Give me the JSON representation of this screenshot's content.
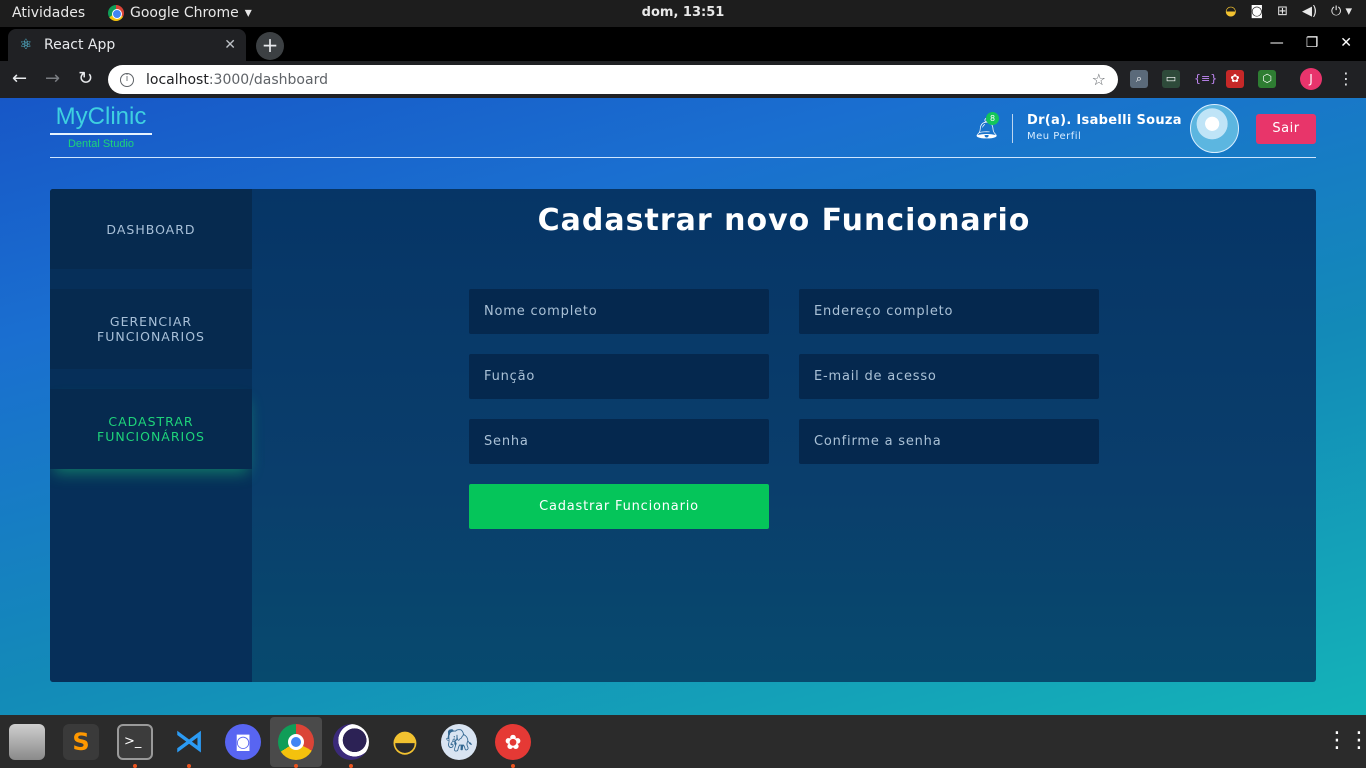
{
  "system": {
    "activities": "Atividades",
    "app_menu": "Google Chrome",
    "clock": "dom, 13:51"
  },
  "browser": {
    "tab_title": "React App",
    "url_host": "localhost",
    "url_path": ":3000/dashboard",
    "profile_initial": "J"
  },
  "header": {
    "brand_name": "MyClinic",
    "brand_sub": "Dental Studio",
    "notification_count": "8",
    "user_name": "Dr(a). Isabelli Souza",
    "user_link": "Meu Perfil",
    "logout_label": "Sair"
  },
  "sidebar": {
    "items": [
      {
        "label": "DASHBOARD"
      },
      {
        "label": "GERENCIAR FUNCIONARIOS"
      },
      {
        "label": "CADASTRAR FUNCIONÁRIOS"
      }
    ]
  },
  "form": {
    "title": "Cadastrar novo Funcionario",
    "fields": {
      "name": {
        "placeholder": "Nome completo"
      },
      "address": {
        "placeholder": "Endereço completo"
      },
      "role": {
        "placeholder": "Função"
      },
      "email": {
        "placeholder": "E-mail de acesso"
      },
      "password": {
        "placeholder": "Senha"
      },
      "password_confirm": {
        "placeholder": "Confirme a senha"
      }
    },
    "submit_label": "Cadastrar Funcionario"
  },
  "colors": {
    "accent_green": "#05c55a",
    "logout_pink": "#e8356a",
    "brand_cyan": "#3ed0e0",
    "panel_navy": "#063566"
  },
  "icons": {
    "topbar": [
      "chrome-icon",
      "weather-icon",
      "discord-icon",
      "network-icon",
      "volume-icon",
      "power-icon"
    ],
    "dock": [
      "files-icon",
      "sublime-text-icon",
      "terminal-icon",
      "vscode-icon",
      "discord-icon",
      "chrome-icon",
      "eclipse-icon",
      "mongodb-compass-icon",
      "postgres-icon",
      "insomnia-icon",
      "app-grid-icon"
    ]
  }
}
